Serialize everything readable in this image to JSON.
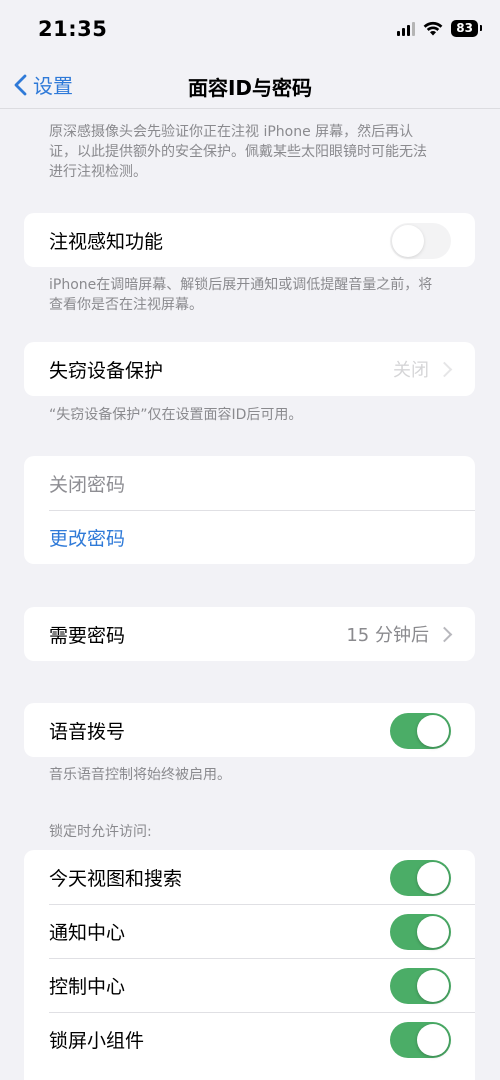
{
  "status": {
    "time": "21:35",
    "battery": "83",
    "icons": [
      "signal-icon",
      "wifi-icon",
      "battery-icon"
    ]
  },
  "nav": {
    "back_label": "设置",
    "title": "面容ID与密码"
  },
  "attention_note": "原深感摄像头会先验证你正在注视 iPhone 屏幕，然后再认证，以此提供额外的安全保护。佩戴某些太阳眼镜时可能无法进行注视检测。",
  "attention_aware": {
    "label": "注视感知功能",
    "enabled": false,
    "note": "iPhone在调暗屏幕、解锁后展开通知或调低提醒音量之前，将查看你是否在注视屏幕。"
  },
  "stolen_device": {
    "label": "失窃设备保护",
    "value": "关闭",
    "note": "“失窃设备保护”仅在设置面容ID后可用。"
  },
  "passcode": {
    "turn_off_label": "关闭密码",
    "change_label": "更改密码"
  },
  "require_passcode": {
    "label": "需要密码",
    "value": "15 分钟后"
  },
  "voice_dial": {
    "label": "语音拨号",
    "enabled": true,
    "note": "音乐语音控制将始终被启用。"
  },
  "locked_access": {
    "header": "锁定时允许访问:",
    "items": [
      {
        "label": "今天视图和搜索",
        "enabled": true
      },
      {
        "label": "通知中心",
        "enabled": true
      },
      {
        "label": "控制中心",
        "enabled": true
      },
      {
        "label": "锁屏小组件",
        "enabled": true
      }
    ]
  },
  "colors": {
    "accent": "#2f7ad8",
    "toggle_on": "#4bad67",
    "background": "#f2f2f6"
  }
}
